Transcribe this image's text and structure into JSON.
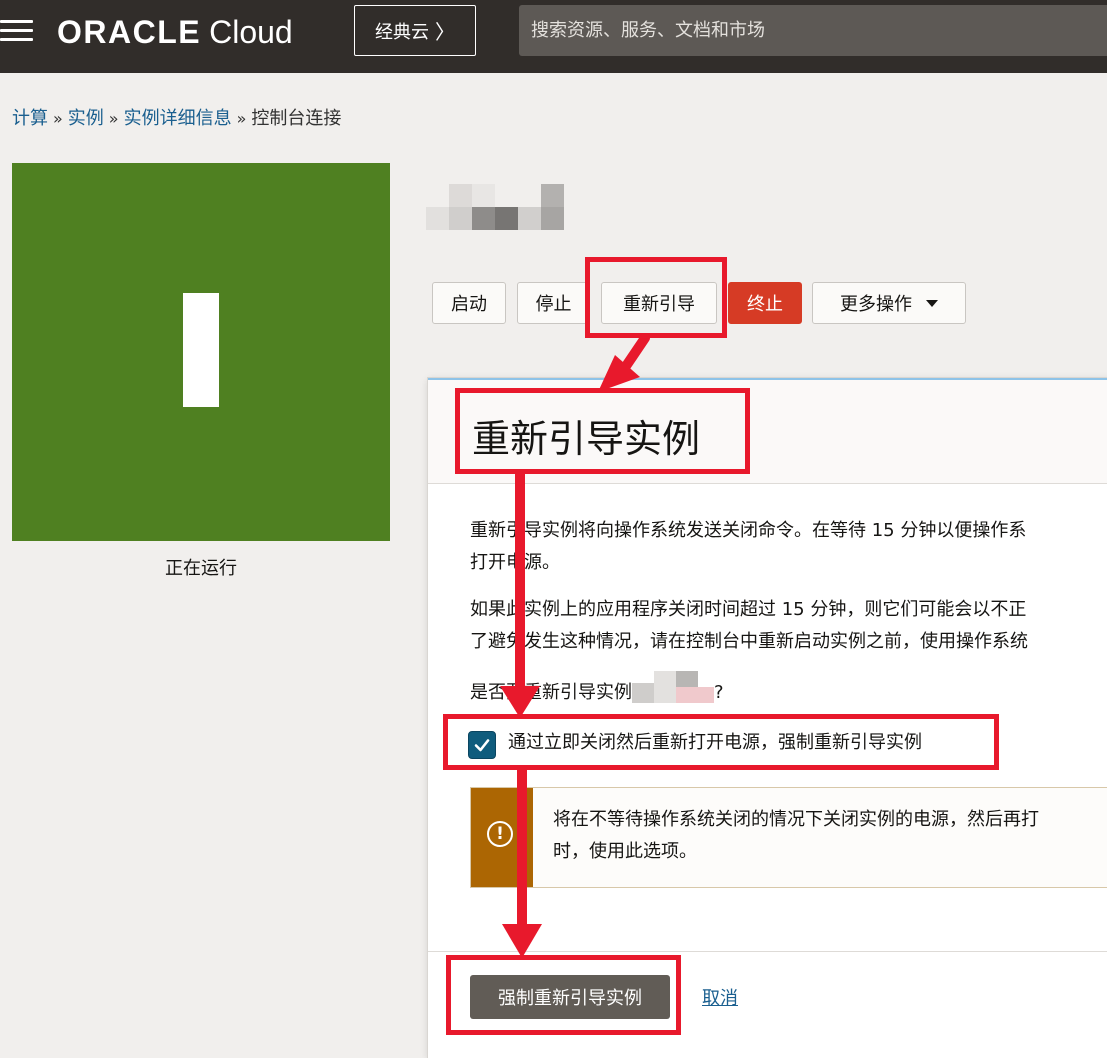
{
  "header": {
    "menu_icon": "hamburger-menu-icon",
    "logo_brand": "ORACLE",
    "logo_product": "Cloud",
    "classic_button": "经典云",
    "classic_chevron": "〉",
    "search_placeholder": "搜索资源、服务、文档和市场",
    "bar_color": "#312d2a"
  },
  "breadcrumb": {
    "items": [
      "计算",
      "实例",
      "实例详细信息"
    ],
    "separator": "»",
    "current": "控制台连接"
  },
  "instance": {
    "tile_color": "#4f8021",
    "status": "正在运行"
  },
  "actions": {
    "start": "启动",
    "stop": "停止",
    "reboot": "重新引导",
    "terminate": "终止",
    "more": "更多操作"
  },
  "dialog": {
    "title": "重新引导实例",
    "para1_line1": "重新引导实例将向操作系统发送关闭命令。在等待 15 分钟以便操作系",
    "para1_line2": "打开电源。",
    "para2_line1": "如果此实例上的应用程序关闭时间超过 15 分钟，则它们可能会以不正",
    "para2_line2": "了避免发生这种情况，请在控制台中重新启动实例之前，使用操作系统",
    "question": "是否要重新引导实例",
    "question_suffix": "?",
    "checkbox_label": "通过立即关闭然后重新打开电源，强制重新引导实例",
    "checkbox_checked": true,
    "warning_icon": "exclamation-icon",
    "warning_line1": "将在不等待操作系统关闭的情况下关闭实例的电源，然后再打",
    "warning_line2": "时，使用此选项。",
    "primary_button": "强制重新引导实例",
    "cancel": "取消"
  },
  "colors": {
    "link": "#1a5f8f",
    "danger": "#d63b25",
    "primary_button": "#615c56",
    "checkbox": "#0f5c7d",
    "warning": "#ac6603",
    "annotation": "#e8192c"
  }
}
